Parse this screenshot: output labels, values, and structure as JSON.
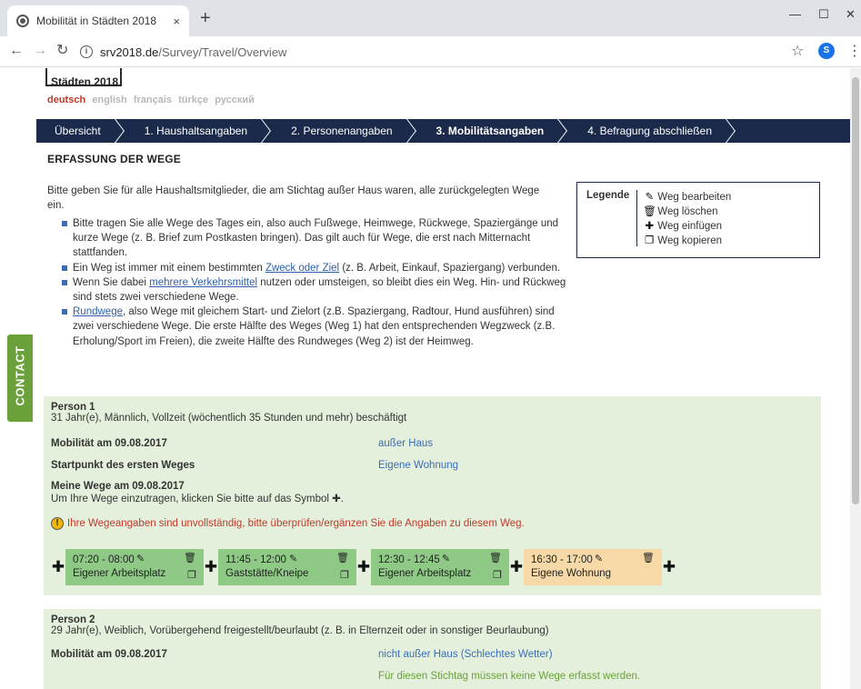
{
  "browser": {
    "tab_title": "Mobilität in Städten 2018",
    "tab_close": "×",
    "new_tab": "+",
    "url_host": "srv2018.de",
    "url_path": "/Survey/Travel/Overview",
    "profile_initial": "S",
    "win_min": "—",
    "win_max": "☐",
    "win_close": "✕"
  },
  "header": {
    "logo_text": "Städten 2018",
    "languages": [
      "deutsch",
      "english",
      "français",
      "türkçe",
      "русский"
    ],
    "active_language": "deutsch"
  },
  "steps": [
    {
      "label": "Übersicht"
    },
    {
      "label": "1. Haushaltsangaben"
    },
    {
      "label": "2. Personenangaben"
    },
    {
      "label": "3. Mobilitätsangaben"
    },
    {
      "label": "4. Befragung abschließen"
    }
  ],
  "section_title": "ERFASSUNG DER WEGE",
  "intro": "Bitte geben Sie für alle Haushaltsmitglieder, die am Stichtag außer Haus waren, alle zurückgelegten Wege ein.",
  "bullets": {
    "b1": "Bitte tragen Sie alle Wege des Tages ein, also auch Fußwege, Heimwege, Rückwege, Spaziergänge und kurze Wege (z. B. Brief zum Postkasten bringen). Das gilt auch für Wege, die erst nach Mitternacht stattfanden.",
    "b2_pre": "Ein Weg ist immer mit einem bestimmten ",
    "b2_link": "Zweck oder Ziel",
    "b2_post": " (z. B. Arbeit, Einkauf, Spaziergang) verbunden.",
    "b3_pre": "Wenn Sie dabei ",
    "b3_link": "mehrere Verkehrsmittel",
    "b3_post": " nutzen oder umsteigen, so bleibt dies ein Weg. Hin- und Rückweg sind stets zwei verschiedene Wege.",
    "b4_link": "Rundwege",
    "b4_post": ", also Wege mit gleichem Start- und Zielort (z.B. Spaziergang, Radtour, Hund ausführen) sind zwei verschiedene Wege. Die erste Hälfte des Weges (Weg 1) hat den entsprechenden Wegzweck (z.B. Erholung/Sport im Freien), die zweite Hälfte des Rundweges (Weg 2) ist der Heimweg."
  },
  "legend": {
    "label": "Legende",
    "edit": "Weg bearbeiten",
    "delete": "Weg löschen",
    "insert": "Weg einfügen",
    "copy": "Weg kopieren"
  },
  "contact": "CONTACT",
  "person1": {
    "name": "Person 1",
    "desc": "31 Jahr(e), Männlich, Vollzeit (wöchentlich 35 Stunden und mehr) beschäftigt",
    "mobility_label": "Mobilität am 09.08.2017",
    "mobility_value": "außer Haus",
    "start_label": "Startpunkt des ersten Weges",
    "start_value": "Eigene Wohnung",
    "ways_label": "Meine Wege am 09.08.2017",
    "ways_hint": "Um Ihre Wege einzutragen, klicken Sie bitte auf das Symbol",
    "warning": "Ihre Wegeangaben sind unvollständig, bitte überprüfen/ergänzen Sie die Angaben zu diesem Weg.",
    "trips": [
      {
        "time": "07:20 - 08:00",
        "place": "Eigener Arbeitsplatz",
        "status": "complete"
      },
      {
        "time": "11:45 - 12:00",
        "place": "Gaststätte/Kneipe",
        "status": "complete"
      },
      {
        "time": "12:30 - 12:45",
        "place": "Eigener Arbeitsplatz",
        "status": "complete"
      },
      {
        "time": "16:30 - 17:00",
        "place": "Eigene Wohnung",
        "status": "incomplete"
      }
    ]
  },
  "person2": {
    "name": "Person 2",
    "desc": "29 Jahr(e), Weiblich, Vorübergehend freigestellt/beurlaubt (z. B. in Elternzeit oder in sonstiger Beurlaubung)",
    "mobility_label": "Mobilität am 09.08.2017",
    "mobility_value": "nicht außer Haus (Schlechtes Wetter)",
    "note": "Für diesen Stichtag müssen keine Wege erfasst werden."
  },
  "colors": {
    "nav_bg": "#1b2a4a",
    "person_bg": "#e4f0dc",
    "trip_complete": "#8ec986",
    "trip_incomplete": "#f7d8a7",
    "warning": "#c0392b",
    "link": "#2e5fa7",
    "contact": "#6aa13a"
  }
}
